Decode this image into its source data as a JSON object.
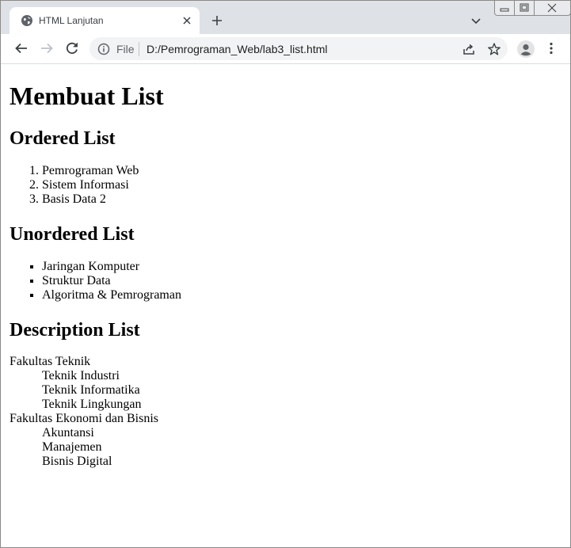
{
  "browser": {
    "tab": {
      "title": "HTML Lanjutan",
      "favicon": "globe-icon"
    },
    "address_bar": {
      "scheme_label": "File",
      "url": "D:/Pemrograman_Web/lab3_list.html"
    }
  },
  "page": {
    "heading": "Membuat List",
    "ordered": {
      "heading": "Ordered List",
      "items": [
        "Pemrograman Web",
        "Sistem Informasi",
        "Basis Data 2"
      ]
    },
    "unordered": {
      "heading": "Unordered List",
      "items": [
        "Jaringan Komputer",
        "Struktur Data",
        "Algoritma & Pemrograman"
      ]
    },
    "description": {
      "heading": "Description List",
      "groups": [
        {
          "term": "Fakultas Teknik",
          "descriptions": [
            "Teknik Industri",
            "Teknik Informatika",
            "Teknik Lingkungan"
          ]
        },
        {
          "term": "Fakultas Ekonomi dan Bisnis",
          "descriptions": [
            "Akuntansi",
            "Manajemen",
            "Bisnis Digital"
          ]
        }
      ]
    }
  },
  "colors": {
    "tabstrip": "#dee1e6",
    "omnibox": "#f1f3f4",
    "icon": "#5f6368"
  }
}
